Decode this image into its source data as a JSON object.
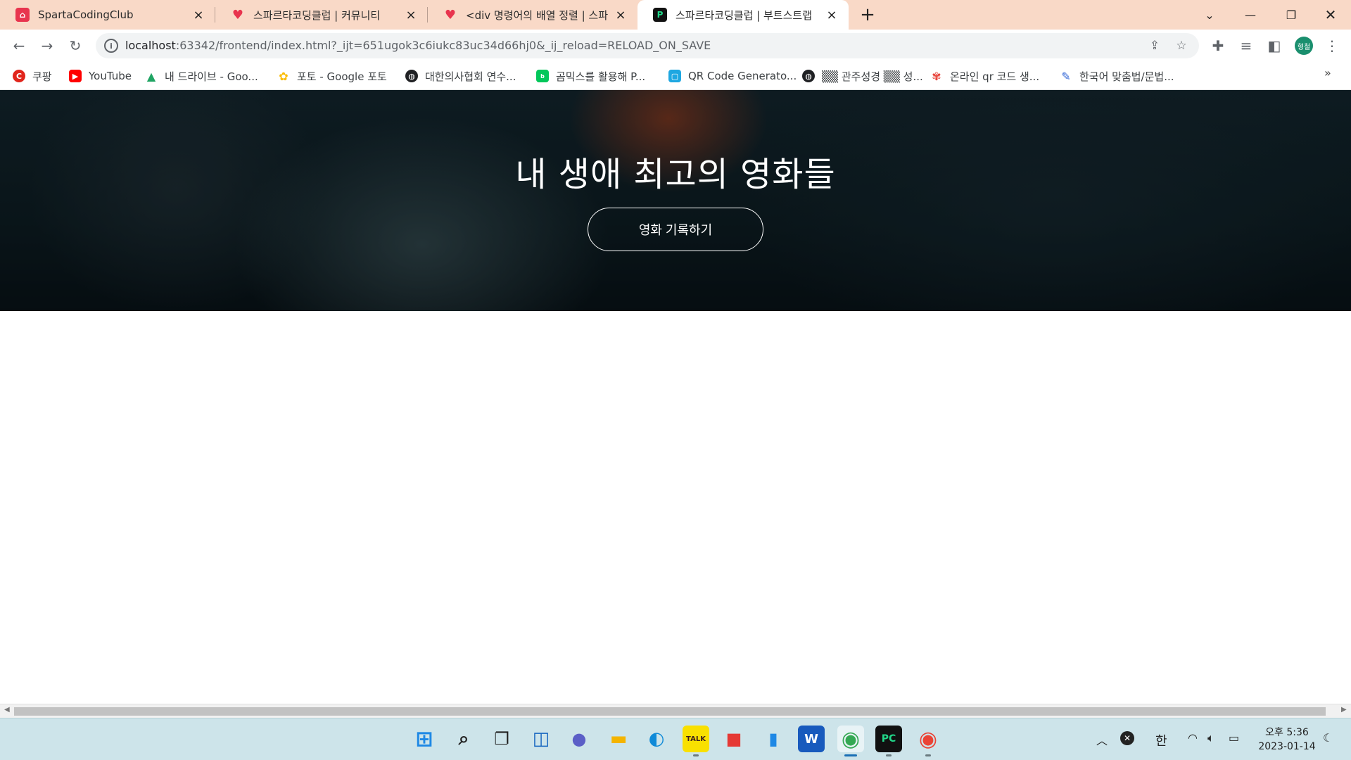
{
  "tabs": [
    {
      "title": "SpartaCodingClub",
      "favicon": "sparta-icon"
    },
    {
      "title": "스파르타코딩클럽 | 커뮤니티",
      "favicon": "heart-icon"
    },
    {
      "title": "<div 명령어의 배열 정렬 | 스파르",
      "favicon": "heart-icon"
    },
    {
      "title": "스파르타코딩클럽 | 부트스트랩 ",
      "favicon": "pycharm-icon"
    }
  ],
  "address_bar": {
    "host": "localhost",
    "rest": ":63342/frontend/index.html?_ijt=651ugok3c6iukc83uc34d66hj0&_ij_reload=RELOAD_ON_SAVE"
  },
  "profile_initials": "형철",
  "bookmarks": [
    {
      "label": "쿠팡",
      "icon": "coupang-icon",
      "color": "#e1251b"
    },
    {
      "label": "YouTube",
      "icon": "youtube-icon",
      "color": "#ff0000"
    },
    {
      "label": "내 드라이브 - Goo...",
      "icon": "google-drive-icon",
      "color": "#1fa463"
    },
    {
      "label": "포토 - Google 포토",
      "icon": "google-photos-icon",
      "color": "#fbbc04"
    },
    {
      "label": "대한의사협회 연수...",
      "icon": "globe-icon",
      "color": "#202124"
    },
    {
      "label": "곰믹스를 활용해 P...",
      "icon": "blog-icon",
      "color": "#03c75a"
    },
    {
      "label": "QR Code Generato...",
      "icon": "qr-icon",
      "color": "#1ea7e1"
    },
    {
      "label": "▒▒ 관주성경 ▒▒ 성...",
      "icon": "globe-icon",
      "color": "#202124"
    },
    {
      "label": "온라인 qr 코드 생...",
      "icon": "flower-icon",
      "color": "#e8453c"
    },
    {
      "label": "한국어 맞춤법/문법...",
      "icon": "spell-icon",
      "color": "#3367d6"
    }
  ],
  "page": {
    "hero_title": "내 생애 최고의 영화들",
    "hero_button": "영화 기록하기"
  },
  "taskbar": {
    "apps": [
      {
        "name": "start-icon",
        "color": "#1e88e5"
      },
      {
        "name": "search-icon",
        "color": "#222222"
      },
      {
        "name": "task-view-icon",
        "color": "#222222"
      },
      {
        "name": "widgets-icon",
        "color": "#1565c0"
      },
      {
        "name": "teams-chat-icon",
        "color": "#5b5fc7"
      },
      {
        "name": "file-explorer-icon",
        "color": "#f4b400"
      },
      {
        "name": "edge-icon",
        "color": "#0f8ad8"
      },
      {
        "name": "kakaotalk-icon",
        "color": "#f9e000"
      },
      {
        "name": "pdf-app-icon",
        "color": "#e53935"
      },
      {
        "name": "notepad-icon",
        "color": "#1e88e5"
      },
      {
        "name": "word-icon",
        "color": "#185abd"
      },
      {
        "name": "chrome-icon",
        "color": "#34a853"
      },
      {
        "name": "pycharm-icon",
        "color": "#21d789"
      },
      {
        "name": "chrome-profile-icon",
        "color": "#ea4335"
      }
    ],
    "ime": "한",
    "clock_time": "오후 5:36",
    "clock_date": "2023-01-14"
  }
}
